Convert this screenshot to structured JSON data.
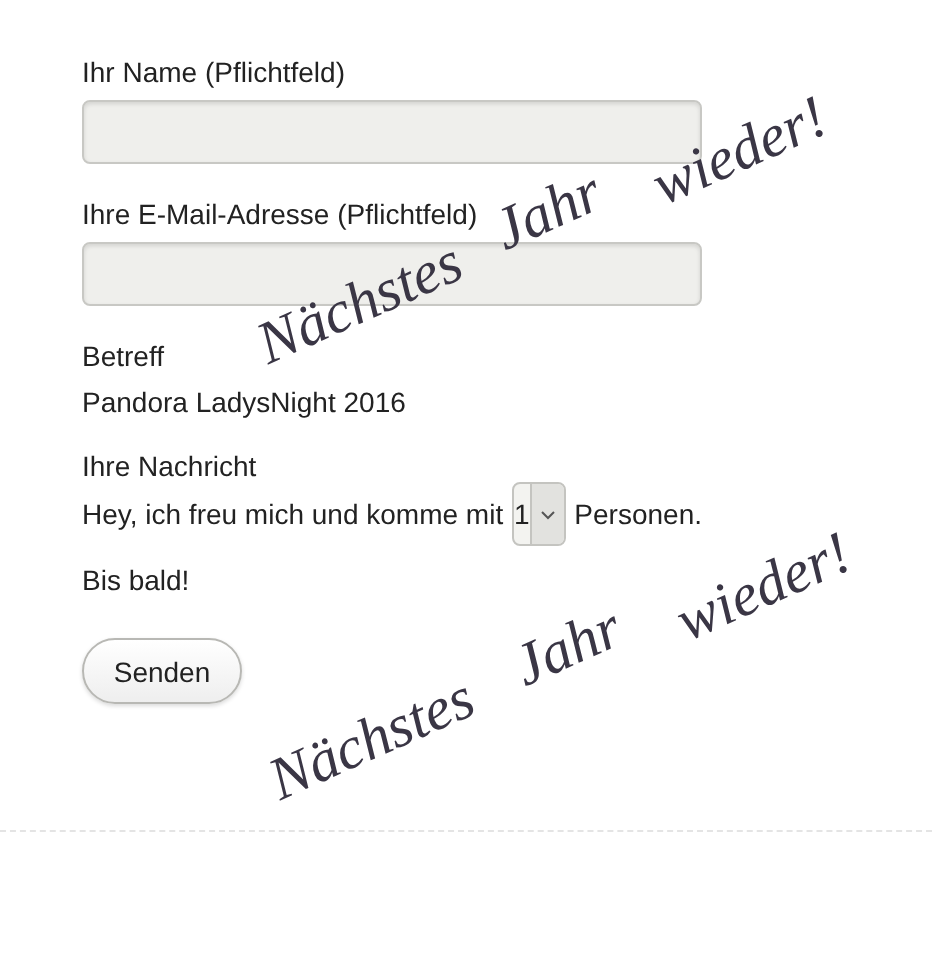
{
  "fields": [
    {
      "label": "Ihr Name (Pflichtfeld)"
    },
    {
      "label": "Ihre E-Mail-Adresse (Pflichtfeld)"
    }
  ],
  "subject": {
    "label": "Betreff",
    "value": "Pandora LadysNight 2016"
  },
  "message": {
    "label": "Ihre Nachricht",
    "before": "Hey, ich freu mich und komme mit",
    "count": "1",
    "after": "Personen.",
    "closing": "Bis bald!"
  },
  "submit": "Senden",
  "stamps": [
    {
      "words": [
        "Nächstes",
        "Jahr",
        "wieder!"
      ]
    },
    {
      "words": [
        "Nächstes",
        "Jahr",
        "wieder!"
      ]
    }
  ]
}
